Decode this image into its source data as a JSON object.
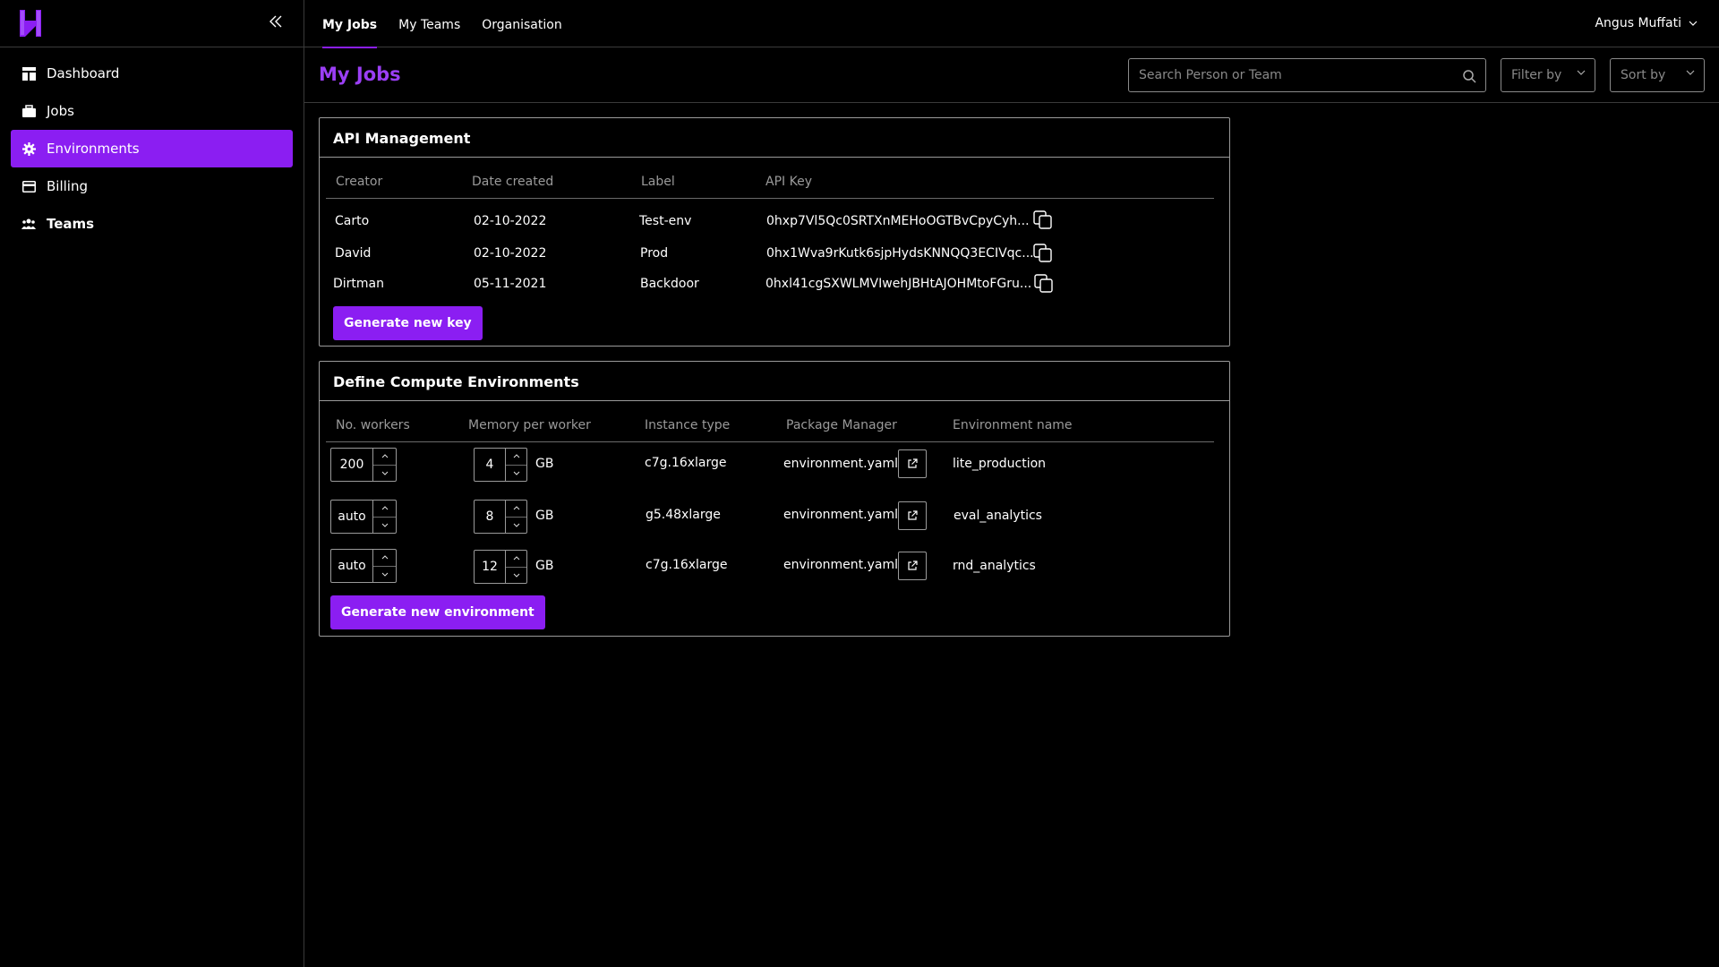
{
  "sidebar": {
    "logo": "H",
    "items": [
      {
        "label": "Dashboard",
        "icon": "dashboard-icon"
      },
      {
        "label": "Jobs",
        "icon": "jobs-icon"
      },
      {
        "label": "Environments",
        "icon": "gear-icon",
        "active": true
      },
      {
        "label": "Billing",
        "icon": "card-icon"
      },
      {
        "label": "Teams",
        "icon": "teams-icon"
      }
    ]
  },
  "topnav": {
    "tabs": [
      "My Jobs",
      "My Teams",
      "Organisation"
    ],
    "active_tab": "My Jobs",
    "user_name": "Angus Muffati"
  },
  "header": {
    "title": "My Jobs",
    "search_placeholder": "Search Person or Team",
    "filter_label": "Filter by",
    "sort_label": "Sort by"
  },
  "api_management": {
    "title": "API Management",
    "columns": [
      "Creator",
      "Date created",
      "Label",
      "API Key"
    ],
    "rows": [
      {
        "creator": "Carto",
        "date": "02-10-2022",
        "label": "Test-env",
        "key": "0hxp7Vl5Qc0SRTXnMEHoOGTBvCpyCyh..."
      },
      {
        "creator": "David",
        "date": "02-10-2022",
        "label": "Prod",
        "key": "0hx1Wva9rKutk6sjpHydsKNNQQ3ECIVqc..."
      },
      {
        "creator": "Dirtman",
        "date": "05-11-2021",
        "label": "Backdoor",
        "key": "0hxl41cgSXWLMVIwehJBHtAJOHMtoFGru..."
      }
    ],
    "button": "Generate new key"
  },
  "environments": {
    "title": "Define Compute Environments",
    "columns": [
      "No. workers",
      "Memory per worker",
      "Instance type",
      "Package Manager",
      "Environment name"
    ],
    "unit": "GB",
    "rows": [
      {
        "workers": "200",
        "memory": "4",
        "instance": "c7g.16xlarge",
        "package": "environment.yaml",
        "name": "lite_production"
      },
      {
        "workers": "auto",
        "memory": "8",
        "instance": "g5.48xlarge",
        "package": "environment.yaml",
        "name": "eval_analytics"
      },
      {
        "workers": "auto",
        "memory": "12",
        "instance": "c7g.16xlarge",
        "package": "environment.yaml",
        "name": "rnd_analytics"
      }
    ],
    "button": "Generate new environment"
  },
  "colors": {
    "accent": "#8b1ef2",
    "title": "#9b3ff5",
    "background": "#000000"
  }
}
